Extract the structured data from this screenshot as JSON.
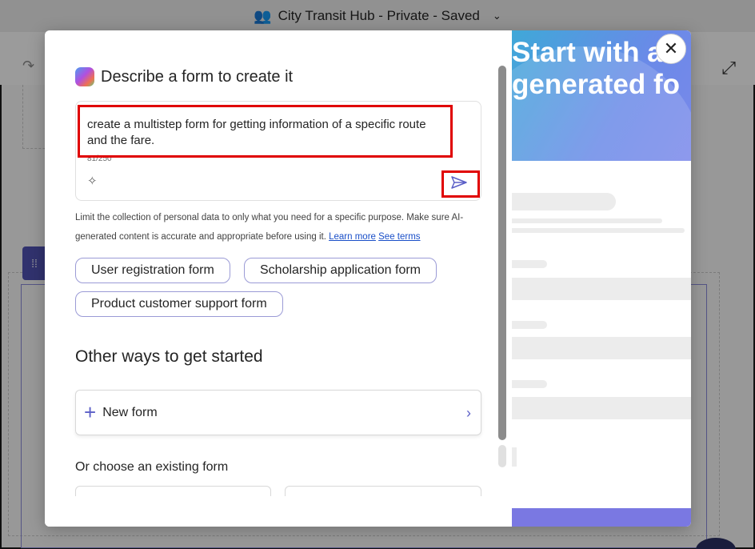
{
  "app": {
    "title": "City Transit Hub - Private - Saved",
    "people_icon": "people-lock-icon",
    "chevron_icon": "chevron-down-icon"
  },
  "dialog": {
    "heading": "Describe a form to create it",
    "prompt": {
      "value": "create a multistep form for getting information of a specific route and the fare.",
      "counter": "81/250"
    },
    "disclaimer": {
      "text": "Limit the collection of personal data to only what you need for a specific purpose. Make sure AI-generated content is accurate and appropriate before using it.",
      "learn_more": "Learn more",
      "see_terms": "See terms"
    },
    "suggestions": [
      "User registration form",
      "Scholarship application form",
      "Product customer support form"
    ],
    "other_heading": "Other ways to get started",
    "new_form_label": "New form",
    "choose_heading": "Or choose an existing form",
    "promo_title": "Start with an\ngenerated fo"
  },
  "colors": {
    "accent": "#5b5fc7",
    "highlight": "#e00000",
    "hero_start": "#3fa8d8",
    "hero_end": "#7a88ea"
  }
}
